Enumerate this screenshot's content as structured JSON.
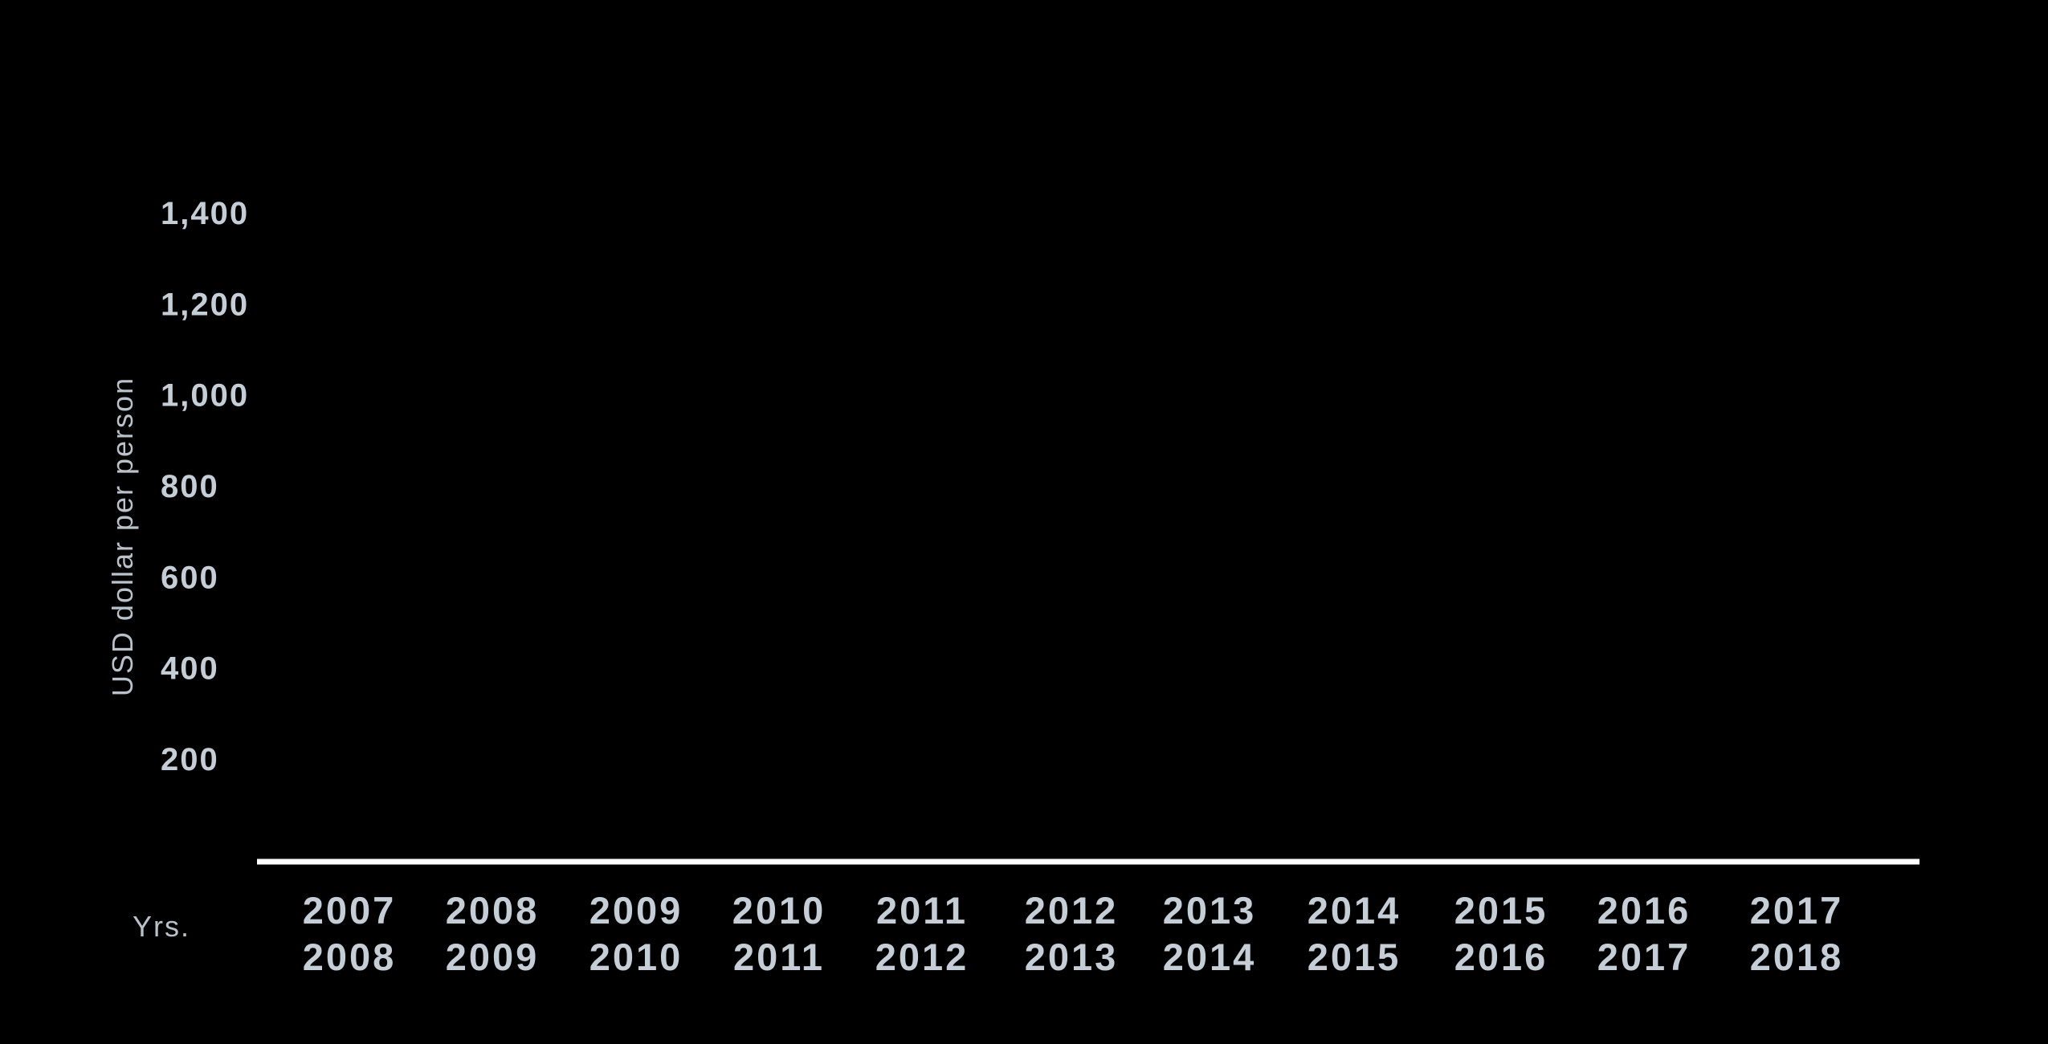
{
  "chart_data": {
    "type": "bar",
    "title": "",
    "ylabel": "USD dollar per person",
    "xlabel": "Yrs.",
    "ylim": [
      0,
      1400
    ],
    "yticks": [
      {
        "value": 200,
        "label": "200"
      },
      {
        "value": 400,
        "label": "400"
      },
      {
        "value": 600,
        "label": "600"
      },
      {
        "value": 800,
        "label": "800"
      },
      {
        "value": 1000,
        "label": "1,000"
      },
      {
        "value": 1200,
        "label": "1,200"
      },
      {
        "value": 1400,
        "label": "1,400"
      }
    ],
    "categories": [
      [
        "2007",
        "2008"
      ],
      [
        "2008",
        "2009"
      ],
      [
        "2009",
        "2010"
      ],
      [
        "2010",
        "2011"
      ],
      [
        "2011",
        "2012"
      ],
      [
        "2012",
        "2013"
      ],
      [
        "2013",
        "2014"
      ],
      [
        "2014",
        "2015"
      ],
      [
        "2015",
        "2016"
      ],
      [
        "2016",
        "2017"
      ],
      [
        "2017",
        "2018"
      ]
    ],
    "values": [],
    "grid": false
  },
  "colors": {
    "background": "#000000",
    "text": "#c5ced6",
    "axis_title": "#b9c2ca",
    "axis_line": "#ffffff"
  }
}
